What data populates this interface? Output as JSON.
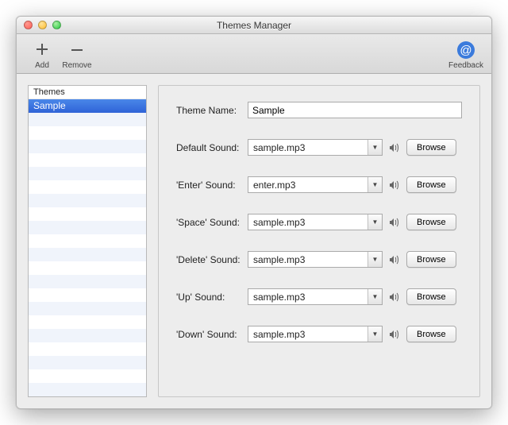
{
  "window": {
    "title": "Themes Manager"
  },
  "toolbar": {
    "add": "Add",
    "remove": "Remove",
    "feedback": "Feedback"
  },
  "sidebar": {
    "header": "Themes",
    "items": [
      {
        "label": "Sample",
        "selected": true
      }
    ],
    "total_rows": 22
  },
  "form": {
    "theme_name": {
      "label": "Theme Name:",
      "value": "Sample"
    },
    "default_sound": {
      "label": "Default Sound:",
      "value": "sample.mp3",
      "browse": "Browse"
    },
    "enter_sound": {
      "label": "'Enter' Sound:",
      "value": "enter.mp3",
      "browse": "Browse"
    },
    "space_sound": {
      "label": "'Space' Sound:",
      "value": "sample.mp3",
      "browse": "Browse"
    },
    "delete_sound": {
      "label": "'Delete' Sound:",
      "value": "sample.mp3",
      "browse": "Browse"
    },
    "up_sound": {
      "label": "'Up' Sound:",
      "value": "sample.mp3",
      "browse": "Browse"
    },
    "down_sound": {
      "label": "'Down' Sound:",
      "value": "sample.mp3",
      "browse": "Browse"
    }
  }
}
